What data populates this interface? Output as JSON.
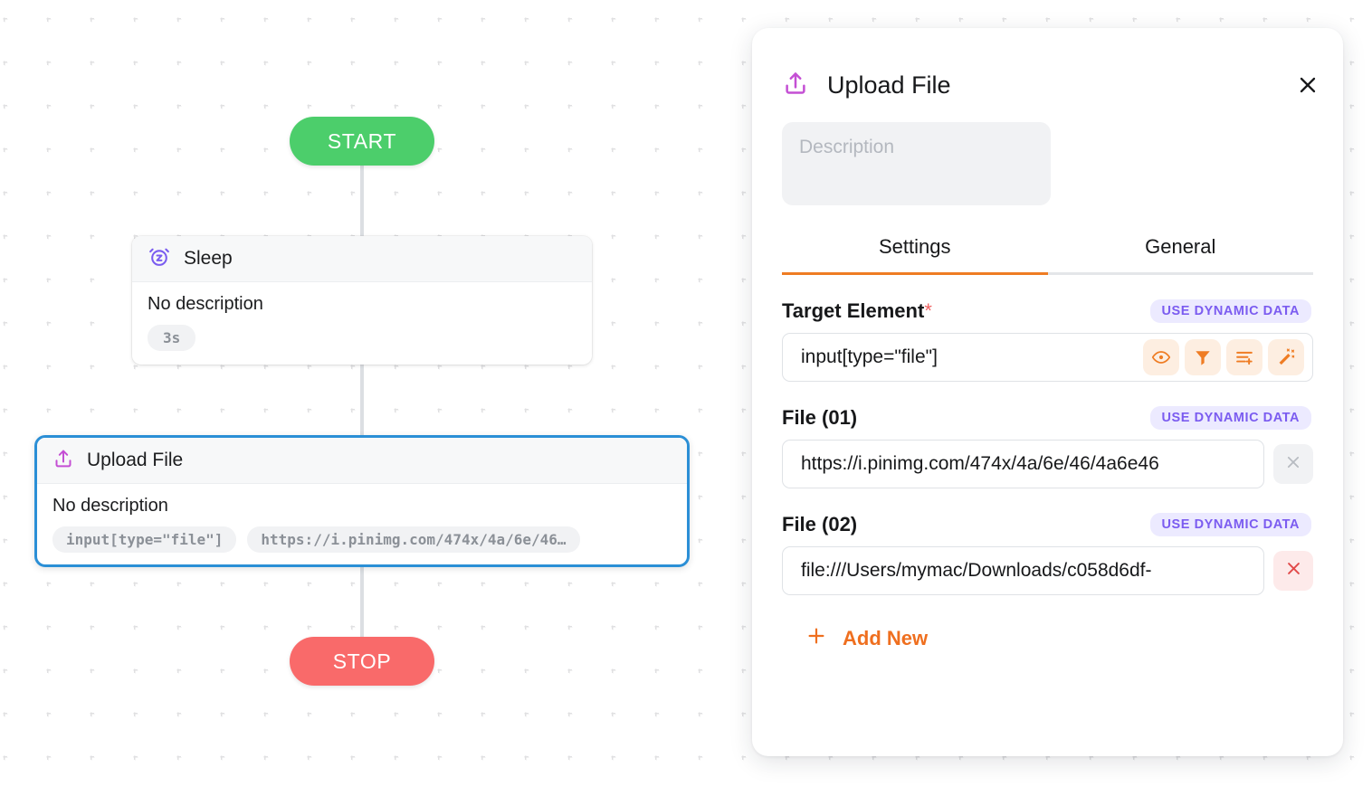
{
  "canvas": {
    "start_label": "START",
    "stop_label": "STOP",
    "nodes": [
      {
        "icon": "alarm-clock-z-icon",
        "title": "Sleep",
        "description": "No description",
        "chips": [
          "3s"
        ]
      },
      {
        "icon": "upload-file-icon",
        "title": "Upload File",
        "description": "No description",
        "chips": [
          "input[type=\"file\"]",
          "https://i.pinimg.com/474x/4a/6e/46…"
        ],
        "selected": true
      }
    ]
  },
  "panel": {
    "icon": "upload-file-icon",
    "title": "Upload File",
    "close_label": "×",
    "description": {
      "value": "",
      "placeholder": "Description"
    },
    "tabs": [
      {
        "label": "Settings",
        "active": true
      },
      {
        "label": "General",
        "active": false
      }
    ],
    "fields": {
      "target_element": {
        "label": "Target Element",
        "required_marker": "*",
        "dynamic_badge": "USE DYNAMIC DATA",
        "value": "input[type=\"file\"]",
        "tools": [
          "eye-icon",
          "filter-funnel-icon",
          "list-plus-icon",
          "magic-wand-icon"
        ]
      },
      "file_01": {
        "label": "File (01)",
        "dynamic_badge": "USE DYNAMIC DATA",
        "value": "https://i.pinimg.com/474x/4a/6e/46/4a6e46",
        "delete_enabled": false
      },
      "file_02": {
        "label": "File (02)",
        "dynamic_badge": "USE DYNAMIC DATA",
        "value": "file:///Users/mymac/Downloads/c058d6df-",
        "delete_enabled": true
      }
    },
    "add_new_label": "Add New"
  },
  "colors": {
    "accent_orange": "#ef7c23",
    "dynamic_purple": "#7b5cf0",
    "start_green": "#4cce6b",
    "stop_red": "#f96a6a",
    "selection_blue": "#2b8fd6",
    "upload_icon_magenta": "#c44fd4",
    "sleep_icon_purple": "#7a5cf0",
    "delete_red": "#e24a4a"
  }
}
